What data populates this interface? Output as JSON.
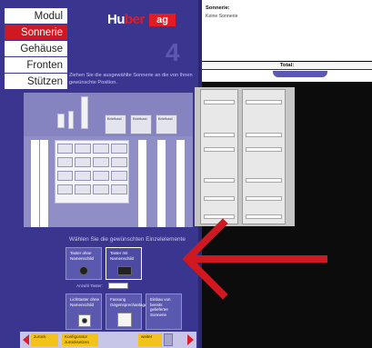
{
  "nav": {
    "items": [
      {
        "label": "Modul"
      },
      {
        "label": "Sonnerie"
      },
      {
        "label": "Gehäuse"
      },
      {
        "label": "Fronten"
      },
      {
        "label": "Stützen"
      }
    ],
    "active_index": 1
  },
  "brand": {
    "logo_part1": "Hu",
    "logo_part2": "ber",
    "logo_tag": "ag"
  },
  "step_number": "4",
  "instruction": "Ziehen Sie die ausgewählte Sonnerie an die von Ihnen gewünschte Position.",
  "design": {
    "top_slots": [
      "Briefkast",
      "Briefkast",
      "Briefkast"
    ]
  },
  "elements": {
    "heading": "Wählen Sie die gewünschten Einzelelemente",
    "tiles": [
      {
        "label": "Taster ohne Namenschild"
      },
      {
        "label": "Taster mit Namenschild"
      },
      {
        "label": "Lichttaster ohne Namenschild"
      },
      {
        "label": "Fassung Gegensprechanlage"
      },
      {
        "label": "Einbau von bereits gelieferter Sonnerie"
      }
    ],
    "count_label": "Anzahl Taster:"
  },
  "footer": {
    "back_label": "zurück",
    "restart_label": "Konfigurator zurücksetzen",
    "next_label": "weiter"
  },
  "summary": {
    "title": "Sonnerie:",
    "value": "Keine Sonnerie",
    "total_label": "Total:"
  },
  "colors": {
    "panel": "#3a3690",
    "accent_red": "#d01820",
    "footer_yellow": "#f4c21c"
  }
}
